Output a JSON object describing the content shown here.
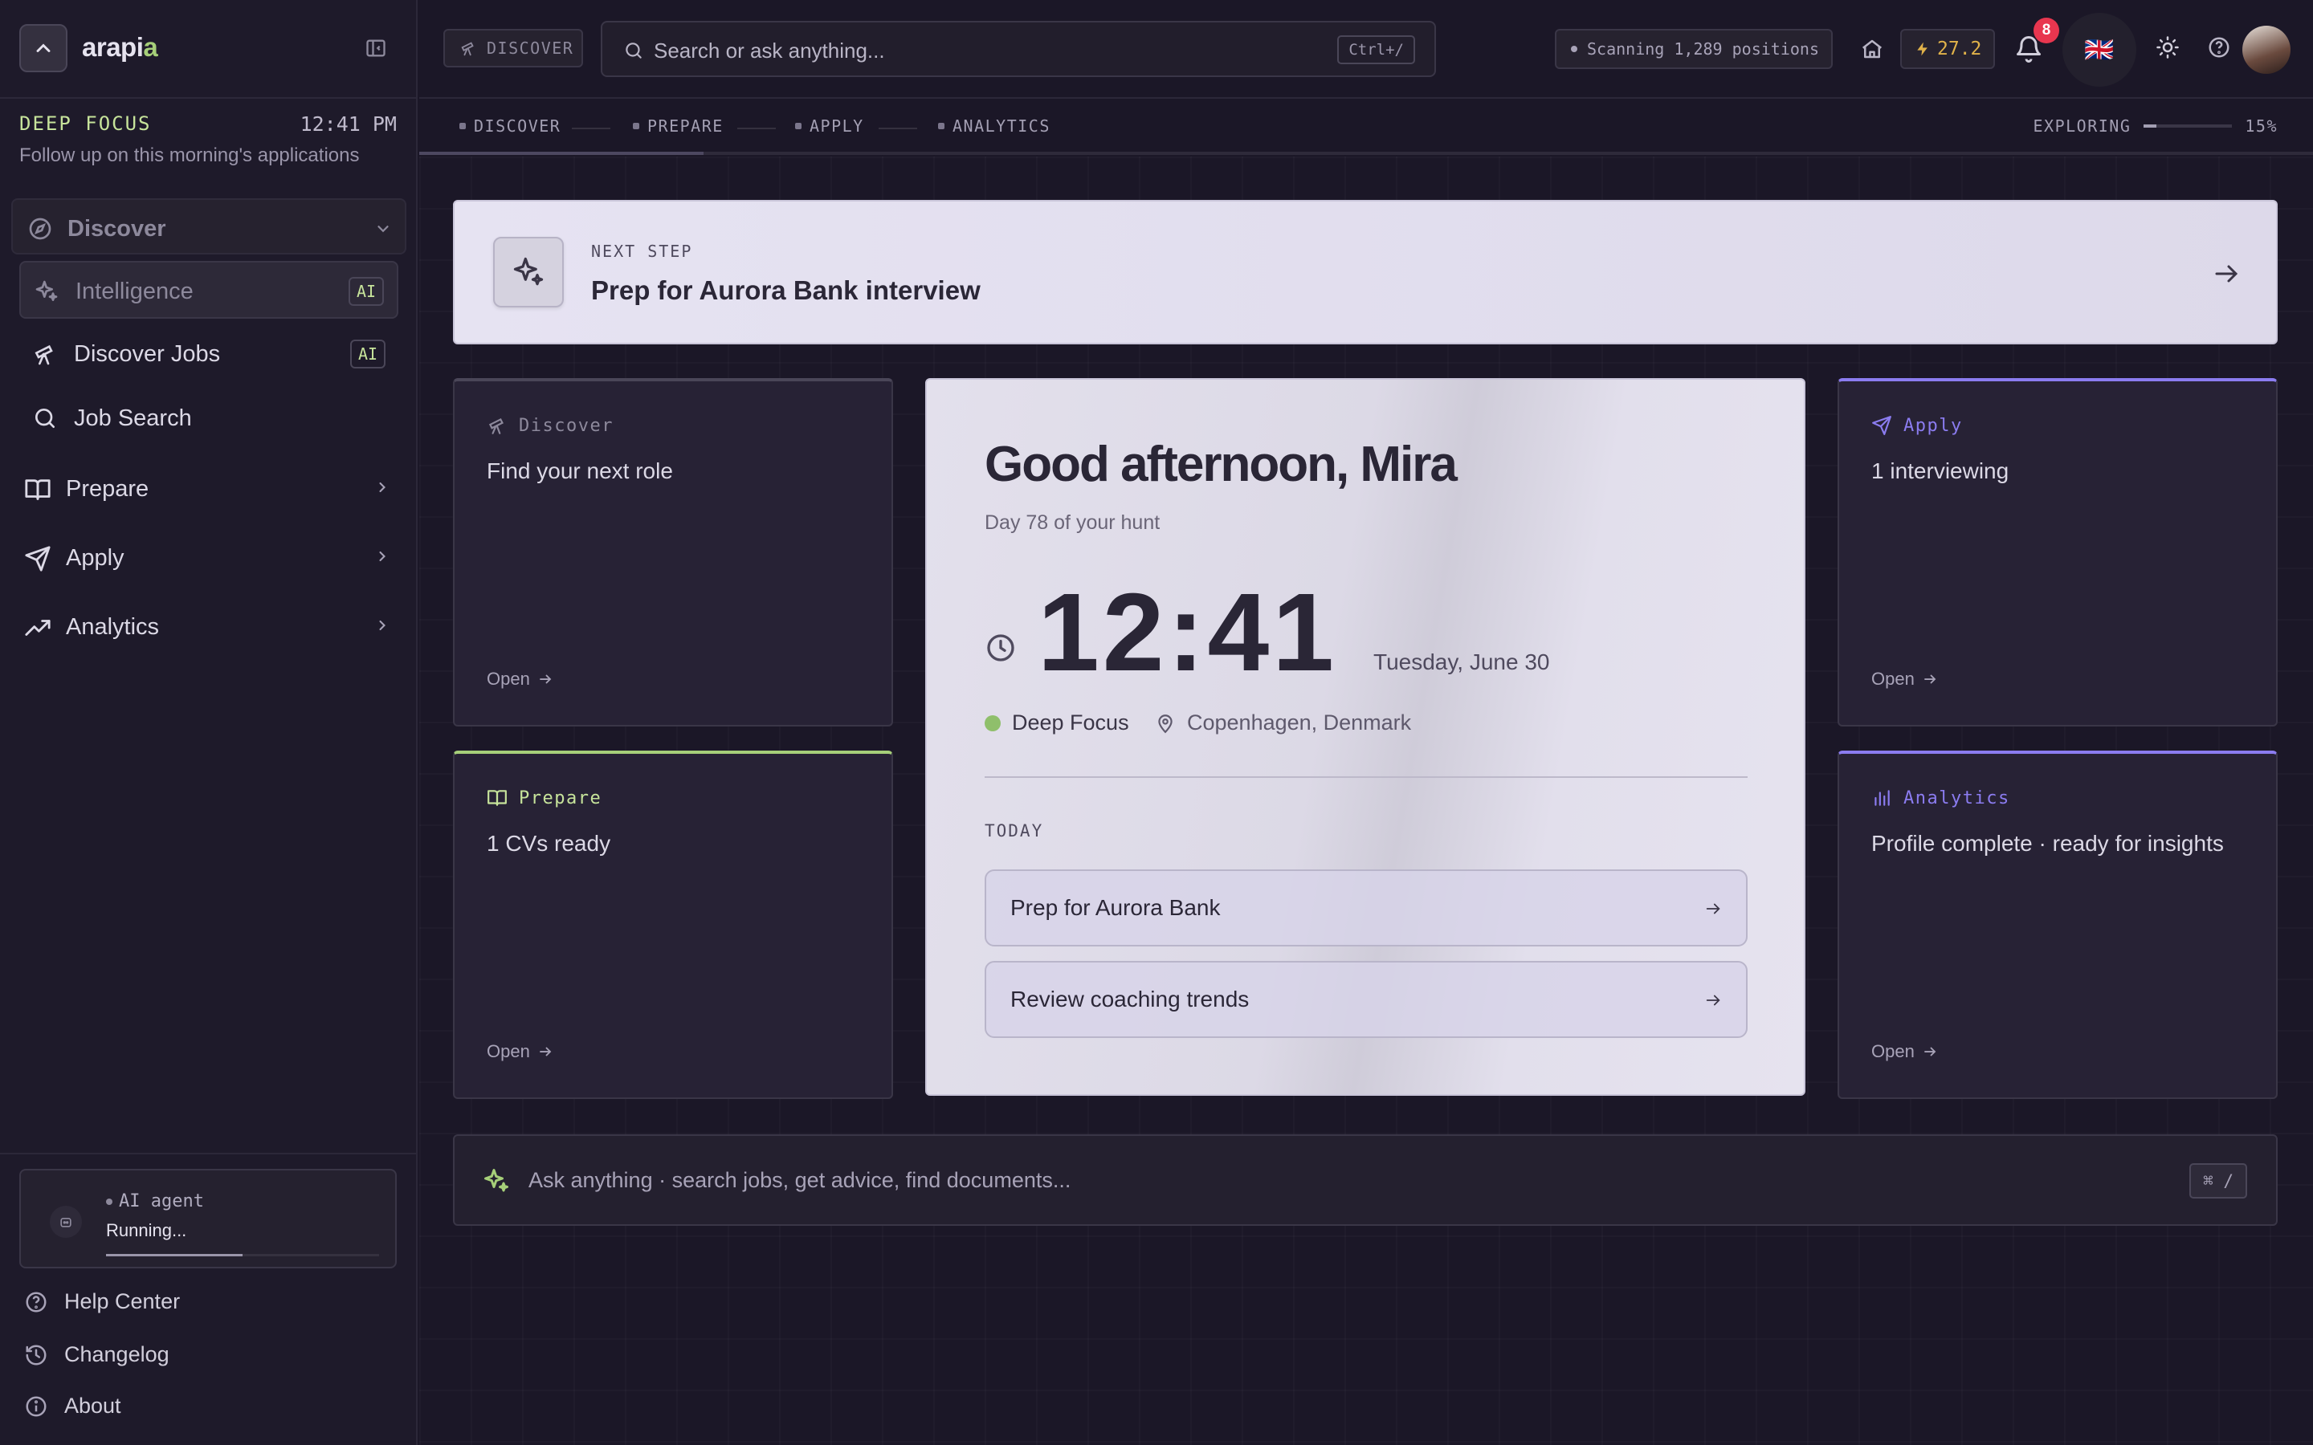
{
  "app": {
    "brand_prefix": "arapi",
    "brand_suffix": "a"
  },
  "focus": {
    "title": "DEEP FOCUS",
    "time": "12:41 PM",
    "subtitle": "Follow up on this morning's applications"
  },
  "nav": {
    "discover": {
      "label": "Discover",
      "items": [
        {
          "label": "Intelligence",
          "badge": "AI"
        },
        {
          "label": "Discover Jobs",
          "badge": "AI"
        },
        {
          "label": "Job Search"
        }
      ]
    },
    "prepare": "Prepare",
    "apply": "Apply",
    "analytics": "Analytics"
  },
  "agent": {
    "title": "AI agent",
    "status": "Running...",
    "progress": 0.5
  },
  "footer_links": [
    "Help Center",
    "Changelog",
    "About"
  ],
  "topbar": {
    "discover_chip": "DISCOVER",
    "search_placeholder": "Search or ask anything...",
    "search_shortcut": "Ctrl+/",
    "scan_status": "Scanning 1,289 positions",
    "score": "27.2",
    "notifications": "8",
    "flag": "🇬🇧"
  },
  "stepper": {
    "steps": [
      "DISCOVER",
      "PREPARE",
      "APPLY",
      "ANALYTICS"
    ],
    "mode": "EXPLORING",
    "percent": "15%"
  },
  "next_step": {
    "kicker": "NEXT STEP",
    "title": "Prep for Aurora Bank interview"
  },
  "cards": {
    "discover": {
      "tag": "Discover",
      "body": "Find your next role",
      "open": "Open"
    },
    "prepare": {
      "tag": "Prepare",
      "body": "1 CVs ready",
      "open": "Open"
    },
    "apply": {
      "tag": "Apply",
      "body": "1 interviewing",
      "open": "Open"
    },
    "analytics": {
      "tag": "Analytics",
      "body": "Profile complete · ready for insights",
      "open": "Open"
    }
  },
  "hero": {
    "greeting": "Good afternoon, Mira",
    "day": "Day 78 of your hunt",
    "time": "12:41",
    "date": "Tuesday, June 30",
    "mode": "Deep Focus",
    "location": "Copenhagen, Denmark",
    "today_label": "TODAY",
    "tasks": [
      "Prep for Aurora Bank",
      "Review coaching trends"
    ]
  },
  "ask": {
    "placeholder": "Ask anything · search jobs, get advice, find documents...",
    "shortcut": "⌘ /"
  },
  "colors": {
    "accent_green": "#a6cf79",
    "accent_purple": "#8b7cf0",
    "badge_red": "#e8364f",
    "score_amber": "#e0b24a"
  }
}
